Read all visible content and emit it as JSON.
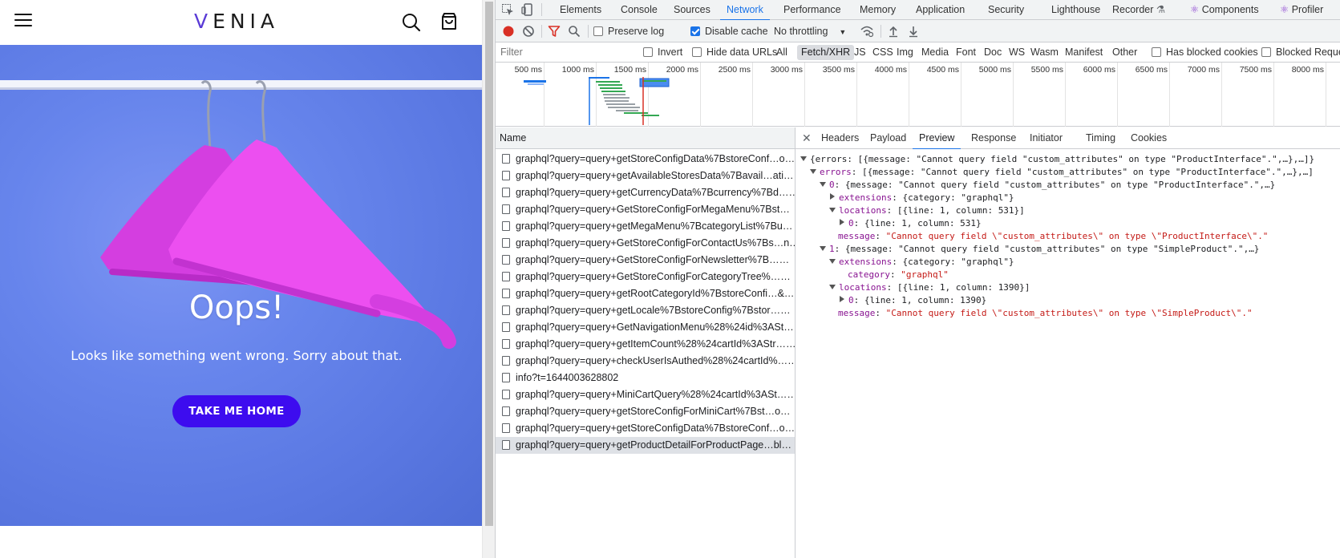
{
  "site": {
    "logo": "VENIA",
    "error_title": "Oops!",
    "error_message": "Looks like something went wrong. Sorry about that.",
    "home_button": "TAKE ME HOME"
  },
  "devtools": {
    "main_tabs": [
      "Elements",
      "Console",
      "Sources",
      "Network",
      "Performance",
      "Memory",
      "Application",
      "Security",
      "Lighthouse",
      "Recorder",
      "Components",
      "Profiler"
    ],
    "active_tab": "Network",
    "toolbar": {
      "preserve_log": "Preserve log",
      "disable_cache": "Disable cache",
      "throttling": "No throttling"
    },
    "filter": {
      "placeholder": "Filter",
      "invert": "Invert",
      "hide_data_urls": "Hide data URLs",
      "types": [
        "All",
        "Fetch/XHR",
        "JS",
        "CSS",
        "Img",
        "Media",
        "Font",
        "Doc",
        "WS",
        "Wasm",
        "Manifest",
        "Other"
      ],
      "active_type": "Fetch/XHR",
      "has_blocked_cookies": "Has blocked cookies",
      "blocked_requests": "Blocked Reque"
    },
    "timeline_ticks": [
      "500 ms",
      "1000 ms",
      "1500 ms",
      "2000 ms",
      "2500 ms",
      "3000 ms",
      "3500 ms",
      "4000 ms",
      "4500 ms",
      "5000 ms",
      "5500 ms",
      "6000 ms",
      "6500 ms",
      "7000 ms",
      "7500 ms",
      "8000 ms"
    ],
    "name_header": "Name",
    "requests": [
      "graphql?query=query+getStoreConfigData%7BstoreConf…o…",
      "graphql?query=query+getAvailableStoresData%7Bavail…ati…",
      "graphql?query=query+getCurrencyData%7Bcurrency%7Bd……",
      "graphql?query=query+GetStoreConfigForMegaMenu%7Bst…",
      "graphql?query=query+getMegaMenu%7BcategoryList%7Bu…",
      "graphql?query=query+GetStoreConfigForContactUs%7Bs…n…",
      "graphql?query=query+GetStoreConfigForNewsletter%7B……",
      "graphql?query=query+GetStoreConfigForCategoryTree%……",
      "graphql?query=query+getRootCategoryId%7BstoreConfi…&…",
      "graphql?query=query+getLocale%7BstoreConfig%7Bstor……",
      "graphql?query=query+GetNavigationMenu%28%24id%3ASt…",
      "graphql?query=query+getItemCount%28%24cartId%3AStr……",
      "graphql?query=query+checkUserIsAuthed%28%24cartId%……",
      "info?t=1644003628802",
      "graphql?query=query+MiniCartQuery%28%24cartId%3ASt……",
      "graphql?query=query+getStoreConfigForMiniCart%7Bst…o…",
      "graphql?query=query+getStoreConfigData%7BstoreConf…o…",
      "graphql?query=query+getProductDetailForProductPage…bl…"
    ],
    "selected_request_index": 17,
    "detail_tabs": [
      "Headers",
      "Payload",
      "Preview",
      "Response",
      "Initiator",
      "Timing",
      "Cookies"
    ],
    "active_detail_tab": "Preview",
    "preview": {
      "l1": "{errors: [{message: \"Cannot query field \"custom_attributes\" on type \"ProductInterface\".\",…},…]}",
      "l2_key": "errors",
      "l2_val": "[{message: \"Cannot query field \"custom_attributes\" on type \"ProductInterface\".\",…},…]",
      "l3_key": "0",
      "l3_val": "{message: \"Cannot query field \"custom_attributes\" on type \"ProductInterface\".\",…}",
      "l4_key": "extensions",
      "l4_val": "{category: \"graphql\"}",
      "l5_key": "locations",
      "l5_val": "[{line: 1, column: 531}]",
      "l6_key": "0",
      "l6_val": "{line: 1, column: 531}",
      "l7_key": "message",
      "l7_val": "\"Cannot query field \\\"custom_attributes\\\" on type \\\"ProductInterface\\\".\"",
      "l8_key": "1",
      "l8_val": "{message: \"Cannot query field \"custom_attributes\" on type \"SimpleProduct\".\",…}",
      "l9_key": "extensions",
      "l9_val": "{category: \"graphql\"}",
      "l10_key": "category",
      "l10_val": "\"graphql\"",
      "l11_key": "locations",
      "l11_val": "[{line: 1, column: 1390}]",
      "l12_key": "0",
      "l12_val": "{line: 1, column: 1390}",
      "l13_key": "message",
      "l13_val": "\"Cannot query field \\\"custom_attributes\\\" on type \\\"SimpleProduct\\\".\""
    }
  }
}
